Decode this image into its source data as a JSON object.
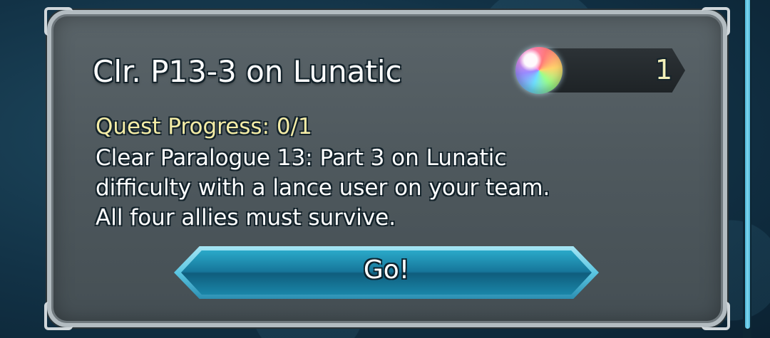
{
  "quest": {
    "title": "Clr. P13-3 on Lunatic",
    "progress_text": "Quest Progress: 0/1",
    "progress": {
      "current": 0,
      "total": 1
    },
    "description": "Clear Paralogue 13: Part 3 on Lunatic difficulty with a lance user on your team. All four allies must survive."
  },
  "reward": {
    "icon": "orb-icon",
    "count": "1"
  },
  "button": {
    "label": "Go!"
  },
  "colors": {
    "panel": "#4f595e",
    "progress_text": "#f4eca6",
    "button": "#2aa9c9",
    "scroll_thumb": "#49b3d6"
  }
}
